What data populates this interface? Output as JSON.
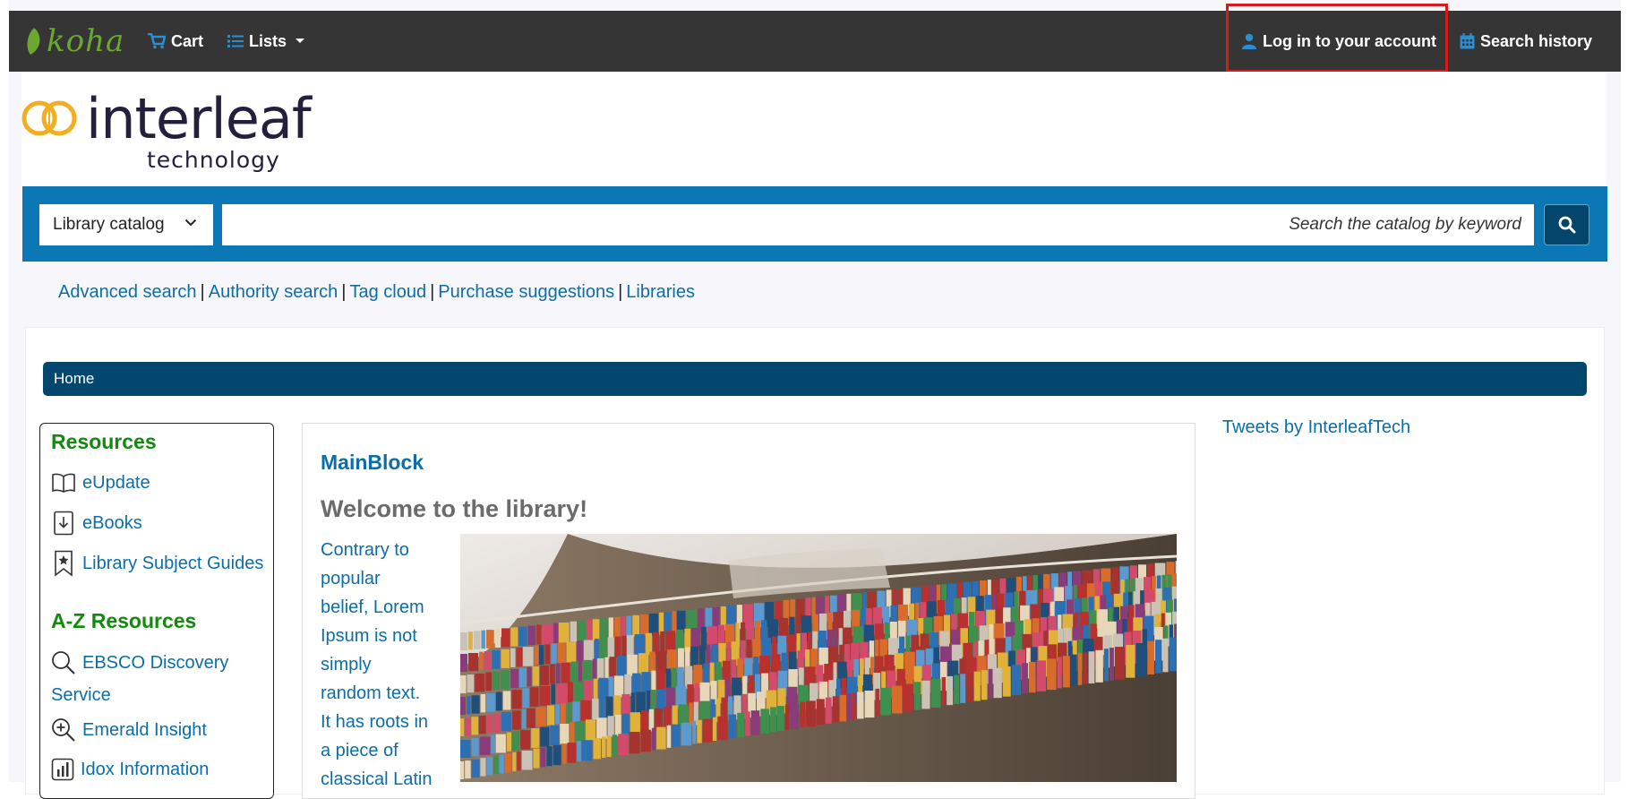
{
  "navbar": {
    "logo_text": "koha",
    "cart": "Cart",
    "lists": "Lists",
    "login": "Log in to your account",
    "search_history": "Search history"
  },
  "brand": {
    "name": "interleaf",
    "tagline": "technology"
  },
  "search": {
    "catalog_option": "Library catalog",
    "placeholder": "Search the catalog by keyword"
  },
  "links": [
    "Advanced search",
    "Authority search",
    "Tag cloud",
    "Purchase suggestions",
    "Libraries"
  ],
  "breadcrumb": "Home",
  "sidebar": {
    "resources_heading": "Resources",
    "resources": [
      "eUpdate",
      "eBooks",
      "Library Subject Guides"
    ],
    "az_heading": "A-Z Resources",
    "az": [
      "EBSCO Discovery",
      "Service",
      "Emerald Insight",
      "Idox Information"
    ]
  },
  "main": {
    "block_title": "MainBlock",
    "welcome": "Welcome to the library!",
    "text_lines": [
      "Contrary to",
      "popular",
      "belief, Lorem",
      "Ipsum is not",
      "simply",
      "random text.",
      "It has roots in",
      "a piece of",
      "classical Latin"
    ]
  },
  "tweets": "Tweets by InterleafTech",
  "colors": {
    "navbar": "#353535",
    "search_band": "#0b77b5",
    "breadcrumb": "#03466e",
    "link": "#0b6ea8",
    "heading_green": "#118a0d",
    "highlight": "#d51b1b"
  }
}
